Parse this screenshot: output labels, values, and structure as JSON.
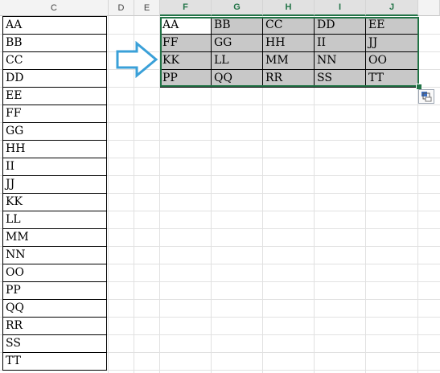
{
  "columns": [
    "C",
    "D",
    "E",
    "F",
    "G",
    "H",
    "I",
    "J"
  ],
  "source_values": [
    "AA",
    "BB",
    "CC",
    "DD",
    "EE",
    "FF",
    "GG",
    "HH",
    "II",
    "JJ",
    "KK",
    "LL",
    "MM",
    "NN",
    "OO",
    "PP",
    "QQ",
    "RR",
    "SS",
    "TT"
  ],
  "transposed_rows": [
    [
      "AA",
      "BB",
      "CC",
      "DD",
      "EE"
    ],
    [
      "FF",
      "GG",
      "HH",
      "II",
      "JJ"
    ],
    [
      "KK",
      "LL",
      "MM",
      "NN",
      "OO"
    ],
    [
      "PP",
      "QQ",
      "RR",
      "SS",
      "TT"
    ]
  ],
  "icons": {
    "arrow": "right-arrow-icon",
    "paste_options": "paste-options-icon"
  },
  "colors": {
    "selection": "#217346",
    "arrow": "#3aa0d8",
    "selected_fill": "#c8c8c8"
  }
}
